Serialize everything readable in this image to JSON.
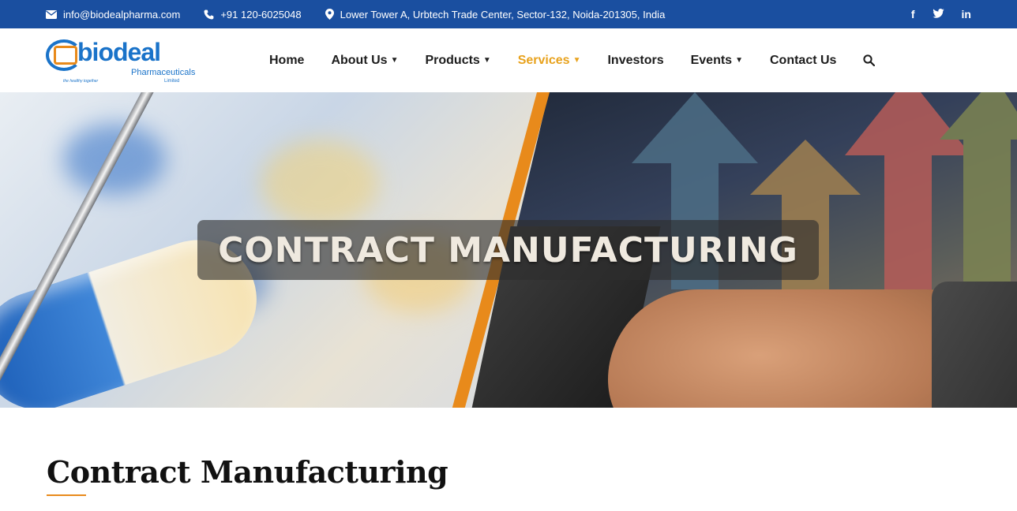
{
  "topbar": {
    "email": "info@biodealpharma.com",
    "phone": "+91 120-6025048",
    "address": "Lower Tower A, Urbtech Trade Center, Sector-132, Noida-201305, India",
    "social": [
      {
        "icon": "facebook-icon",
        "label": "f"
      },
      {
        "icon": "twitter-icon",
        "label": "t"
      },
      {
        "icon": "linkedin-icon",
        "label": "in"
      }
    ]
  },
  "logo": {
    "word": "biodeal",
    "subtitle": "Pharmaceuticals",
    "suffix": "Limited",
    "tagline": "the healthy together"
  },
  "nav": {
    "items": [
      {
        "label": "Home",
        "has_dropdown": false
      },
      {
        "label": "About Us",
        "has_dropdown": true
      },
      {
        "label": "Products",
        "has_dropdown": true
      },
      {
        "label": "Services",
        "has_dropdown": true,
        "active": true
      },
      {
        "label": "Investors",
        "has_dropdown": false
      },
      {
        "label": "Events",
        "has_dropdown": true
      },
      {
        "label": "Contact Us",
        "has_dropdown": false
      }
    ],
    "search_icon": "search-icon"
  },
  "hero": {
    "title": "CONTRACT MANUFACTURING"
  },
  "page": {
    "heading": "Contract Manufacturing"
  },
  "colors": {
    "topbar_bg": "#1a4fa0",
    "accent": "#e8a21d",
    "underline": "#e88a1b",
    "brand_blue": "#1a73c9"
  }
}
